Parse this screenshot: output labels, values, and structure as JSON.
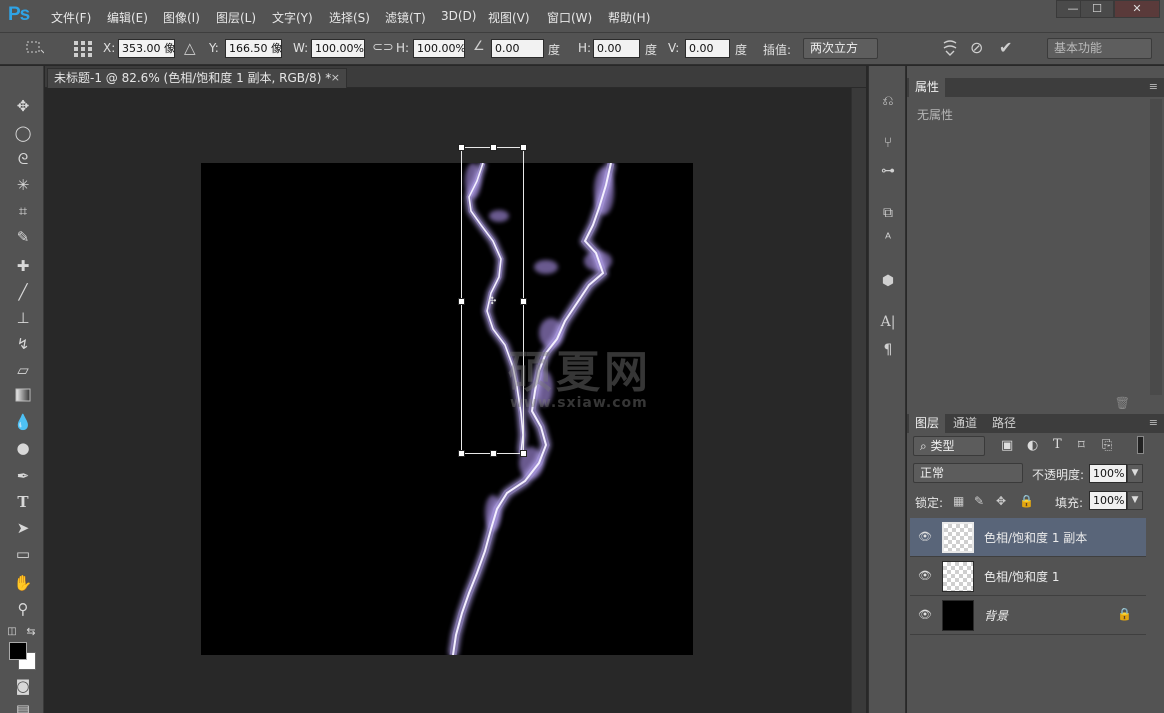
{
  "app": {
    "logo": "Ps"
  },
  "menu": [
    "文件(F)",
    "编辑(E)",
    "图像(I)",
    "图层(L)",
    "文字(Y)",
    "选择(S)",
    "滤镜(T)",
    "3D(D)",
    "视图(V)",
    "窗口(W)",
    "帮助(H)"
  ],
  "window_controls": {
    "minimize": "—",
    "maximize": "☐",
    "close": "✕"
  },
  "options": {
    "x_label": "X:",
    "x_value": "353.00 像",
    "y_label": "Y:",
    "y_value": "166.50 像",
    "w_label": "W:",
    "w_value": "100.00%",
    "h_label": "H:",
    "h_value": "100.00%",
    "angle_value": "0.00",
    "angle_unit": "度",
    "hskew_label": "H:",
    "hskew_value": "0.00",
    "hskew_unit": "度",
    "vskew_label": "V:",
    "vskew_value": "0.00",
    "vskew_unit": "度",
    "interp_label": "插值:",
    "interp_value": "两次立方",
    "workspace": "基本功能"
  },
  "document": {
    "tab_title": "未标题-1 @ 82.6% (色相/饱和度 1 副本, RGB/8) *",
    "close": "×"
  },
  "watermark": {
    "text": "硕夏网",
    "url": "www.sxiaw.com"
  },
  "properties": {
    "tab": "属性",
    "body": "无属性"
  },
  "layers_panel": {
    "tabs": [
      "图层",
      "通道",
      "路径"
    ],
    "filter_kind": "类型",
    "blend_mode": "正常",
    "opacity_label": "不透明度:",
    "opacity_value": "100%",
    "lock_label": "锁定:",
    "fill_label": "填充:",
    "fill_value": "100%",
    "layers": [
      {
        "name": "色相/饱和度 1 副本",
        "selected": true,
        "thumb": "transparent"
      },
      {
        "name": "色相/饱和度 1",
        "selected": false,
        "thumb": "transparent"
      },
      {
        "name": "背景",
        "selected": false,
        "thumb": "black",
        "locked": true
      }
    ]
  }
}
